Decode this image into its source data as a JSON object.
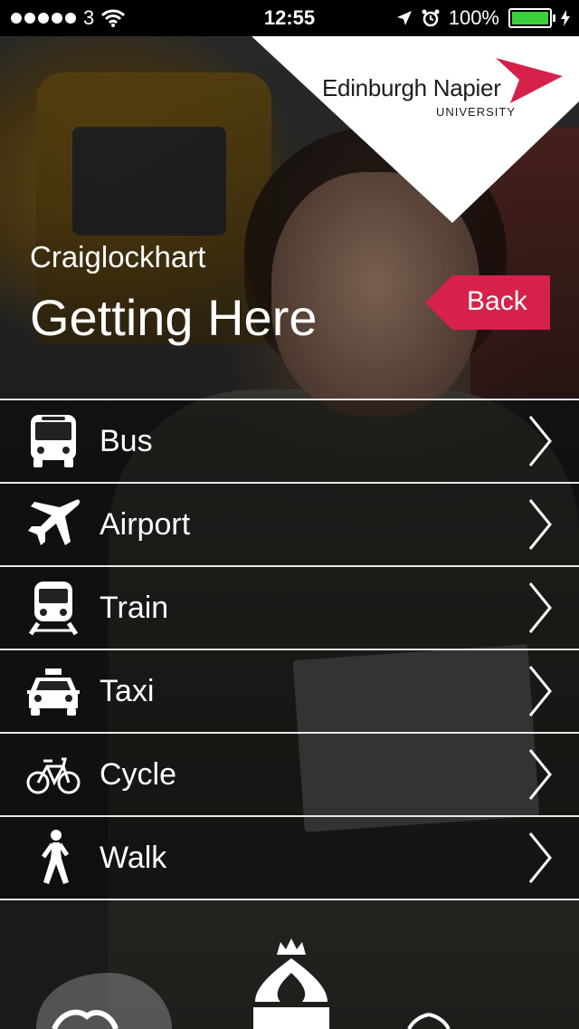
{
  "status_bar": {
    "carrier": "3",
    "time": "12:55",
    "battery": "100%"
  },
  "logo": {
    "line1": "Edinburgh Napier",
    "line2": "UNIVERSITY"
  },
  "header": {
    "campus": "Craiglockhart",
    "title": "Getting Here",
    "back_label": "Back"
  },
  "menu": [
    {
      "label": "Bus",
      "icon": "bus-icon"
    },
    {
      "label": "Airport",
      "icon": "airplane-icon"
    },
    {
      "label": "Train",
      "icon": "train-icon"
    },
    {
      "label": "Taxi",
      "icon": "taxi-icon"
    },
    {
      "label": "Cycle",
      "icon": "bicycle-icon"
    },
    {
      "label": "Walk",
      "icon": "walking-person-icon"
    }
  ],
  "colors": {
    "accent": "#d6214a",
    "battery": "#3ccf3c"
  }
}
